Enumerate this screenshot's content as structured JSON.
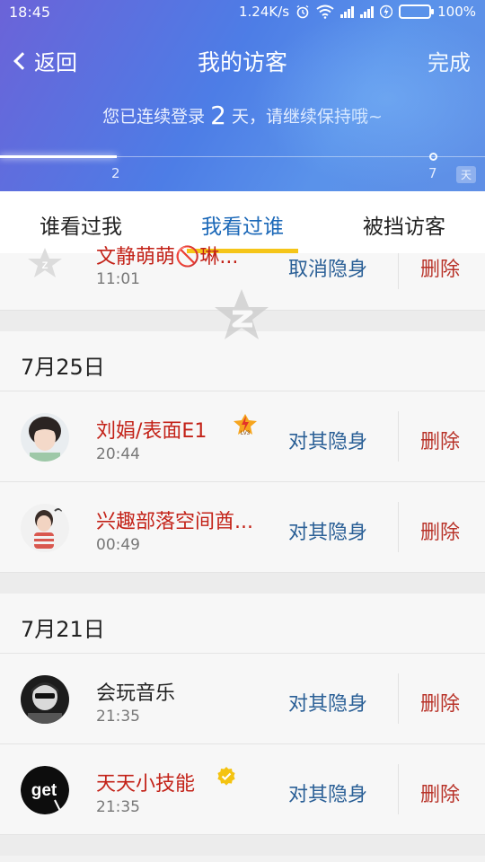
{
  "status_bar": {
    "time": "18:45",
    "net_speed": "1.24K/s",
    "battery": "100%",
    "icons": [
      "alarm-icon",
      "wifi-icon",
      "signal-icon",
      "signal-icon",
      "charging-icon",
      "battery-icon"
    ]
  },
  "nav": {
    "back_label": "返回",
    "title": "我的访客",
    "done_label": "完成"
  },
  "streak": {
    "prefix": "您已连续登录",
    "days": "2",
    "suffix": "天，请继续保持哦~",
    "progress_days": 2,
    "progress_max": 7,
    "start_label": "2",
    "end_label": "7",
    "unit": "天"
  },
  "tabs": [
    {
      "label": "谁看过我",
      "active": false
    },
    {
      "label": "我看过谁",
      "active": true
    },
    {
      "label": "被挡访客",
      "active": false
    }
  ],
  "partial_row": {
    "name": "文静萌萌🚫琳...",
    "time": "11:01",
    "action": "取消隐身",
    "delete": "删除"
  },
  "sections": [
    {
      "date": "7月25日",
      "items": [
        {
          "name": "刘娟/表面E1",
          "time": "20:44",
          "action": "对其隐身",
          "delete": "删除",
          "red": true,
          "badge": "lv-badge-icon"
        },
        {
          "name": "兴趣部落空间酋...",
          "time": "00:49",
          "action": "对其隐身",
          "delete": "删除",
          "red": true
        }
      ]
    },
    {
      "date": "7月21日",
      "items": [
        {
          "name": "会玩音乐",
          "time": "21:35",
          "action": "对其隐身",
          "delete": "删除",
          "red": false
        },
        {
          "name": "天天小技能",
          "time": "21:35",
          "action": "对其隐身",
          "delete": "删除",
          "red": true,
          "badge": "verified-badge-icon"
        }
      ]
    }
  ],
  "colors": {
    "accent_tab": "#1b68b8",
    "tab_indicator": "#f5c518",
    "action_blue": "#2a5f96",
    "delete_red": "#b83228",
    "name_red": "#c32218"
  }
}
